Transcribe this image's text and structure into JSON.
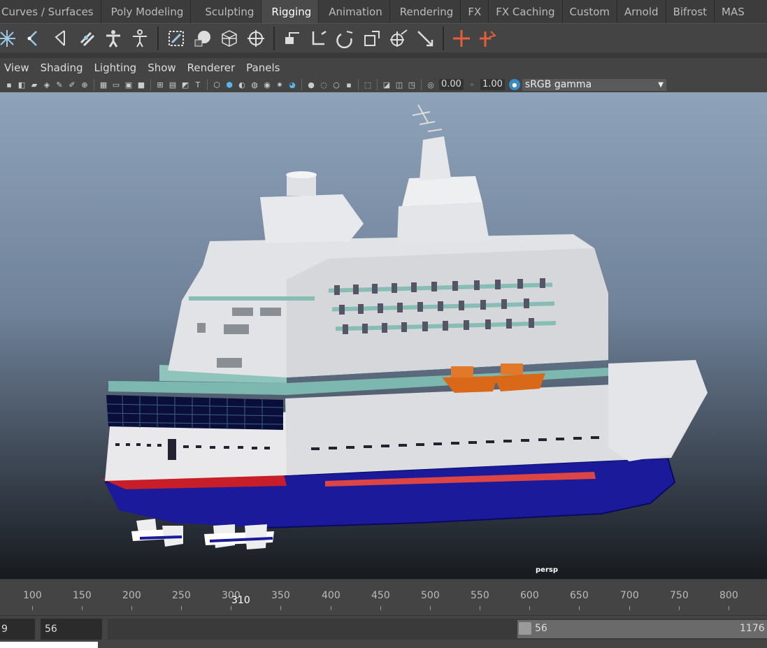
{
  "shelf_tabs": [
    "Curves / Surfaces",
    "Poly Modeling",
    "Sculpting",
    "Rigging",
    "Animation",
    "Rendering",
    "FX",
    "FX Caching",
    "Custom",
    "Arnold",
    "Bifrost",
    "MAS"
  ],
  "active_tab": "Rigging",
  "shelf_icons": [
    "joint-tool-icon",
    "ik-handle-icon",
    "ik-spline-icon",
    "insert-joint-icon",
    "humanik-icon",
    "quick-rig-icon",
    "bind-skin-icon",
    "paint-weights-icon",
    "lattice-icon",
    "cluster-icon",
    "parent-constraint-icon",
    "point-constraint-icon",
    "orient-constraint-icon",
    "scale-constraint-icon",
    "aim-constraint-icon",
    "pole-vector-icon",
    "locator-icon",
    "set-driven-key-icon"
  ],
  "panel_menu": [
    "View",
    "Shading",
    "Lighting",
    "Show",
    "Renderer",
    "Panels"
  ],
  "panel_toolbar": {
    "exposure": "0.00",
    "gamma": "1.00",
    "colorspace": "sRGB gamma"
  },
  "viewport": {
    "camera_label": "persp"
  },
  "timeline": {
    "ticks": [
      "100",
      "150",
      "200",
      "250",
      "300",
      "350",
      "400",
      "450",
      "500",
      "550",
      "600",
      "650",
      "700",
      "750",
      "800"
    ],
    "current_frame": "310"
  },
  "range": {
    "start_field": "9",
    "playback_start": "56",
    "slider_start": "56",
    "slider_end": "1176"
  }
}
